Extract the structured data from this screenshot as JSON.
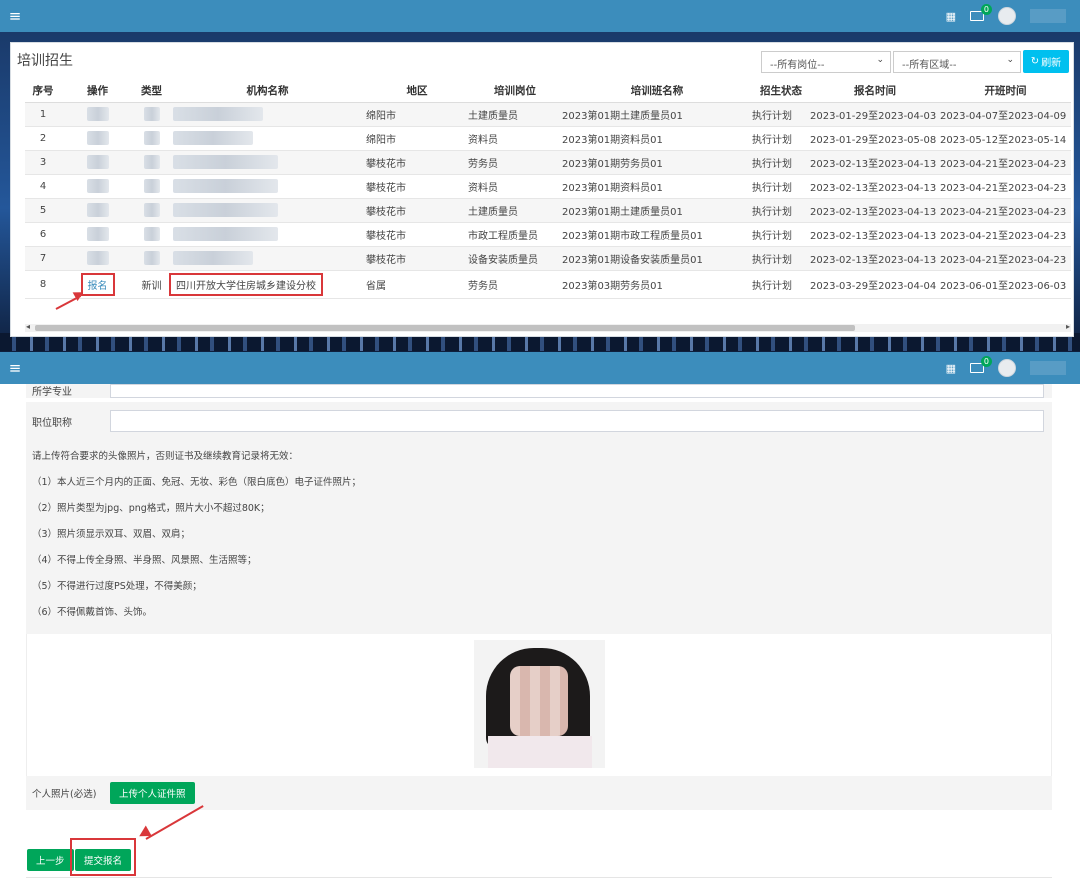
{
  "topbar": {
    "menu_icon": "hamburger-icon",
    "badge_count": "0"
  },
  "panel1": {
    "title": "培训招生",
    "filter_post": "--所有岗位--",
    "filter_area": "--所有区域--",
    "refresh_label": "刷新",
    "columns": [
      "序号",
      "操作",
      "类型",
      "机构名称",
      "地区",
      "培训岗位",
      "培训班名称",
      "招生状态",
      "报名时间",
      "开班时间"
    ],
    "rows": [
      {
        "no": "1",
        "op": "",
        "type": "",
        "org": "",
        "area": "绵阳市",
        "post": "土建质量员",
        "cls": "2023第01期土建质量员01",
        "status": "执行计划",
        "reg": "2023-01-29至2023-04-03",
        "start": "2023-04-07至2023-04-09"
      },
      {
        "no": "2",
        "op": "",
        "type": "",
        "org": "",
        "area": "绵阳市",
        "post": "资料员",
        "cls": "2023第01期资料员01",
        "status": "执行计划",
        "reg": "2023-01-29至2023-05-08",
        "start": "2023-05-12至2023-05-14"
      },
      {
        "no": "3",
        "op": "",
        "type": "",
        "org": "",
        "area": "攀枝花市",
        "post": "劳务员",
        "cls": "2023第01期劳务员01",
        "status": "执行计划",
        "reg": "2023-02-13至2023-04-13",
        "start": "2023-04-21至2023-04-23"
      },
      {
        "no": "4",
        "op": "",
        "type": "",
        "org": "",
        "area": "攀枝花市",
        "post": "资料员",
        "cls": "2023第01期资料员01",
        "status": "执行计划",
        "reg": "2023-02-13至2023-04-13",
        "start": "2023-04-21至2023-04-23"
      },
      {
        "no": "5",
        "op": "",
        "type": "",
        "org": "",
        "area": "攀枝花市",
        "post": "土建质量员",
        "cls": "2023第01期土建质量员01",
        "status": "执行计划",
        "reg": "2023-02-13至2023-04-13",
        "start": "2023-04-21至2023-04-23"
      },
      {
        "no": "6",
        "op": "",
        "type": "",
        "org": "",
        "area": "攀枝花市",
        "post": "市政工程质量员",
        "cls": "2023第01期市政工程质量员01",
        "status": "执行计划",
        "reg": "2023-02-13至2023-04-13",
        "start": "2023-04-21至2023-04-23"
      },
      {
        "no": "7",
        "op": "",
        "type": "",
        "org": "",
        "area": "攀枝花市",
        "post": "设备安装质量员",
        "cls": "2023第01期设备安装质量员01",
        "status": "执行计划",
        "reg": "2023-02-13至2023-04-13",
        "start": "2023-04-21至2023-04-23"
      },
      {
        "no": "8",
        "op": "报名",
        "type": "新训",
        "org": "四川开放大学住房城乡建设分校",
        "area": "省属",
        "post": "劳务员",
        "cls": "2023第03期劳务员01",
        "status": "执行计划",
        "reg": "2023-03-29至2023-04-04",
        "start": "2023-06-01至2023-06-03"
      }
    ]
  },
  "form": {
    "major_label": "所学专业",
    "title_label": "职位职称",
    "notes": [
      "请上传符合要求的头像照片，否则证书及继续教育记录将无效：",
      "（1）本人近三个月内的正面、免冠、无妆、彩色（限白底色）电子证件照片；",
      "（2）照片类型为jpg、png格式，照片大小不超过80K；",
      "（3）照片须显示双耳、双眉、双肩；",
      "（4）不得上传全身照、半身照、风景照、生活照等；",
      "（5）不得进行过度PS处理，不得美颜；",
      "（6）不得佩戴首饰、头饰。"
    ],
    "photo_label": "个人照片(必选)",
    "upload_label": "上传个人证件照",
    "prev_label": "上一步",
    "submit_label": "提交报名"
  },
  "colors": {
    "header": "#3c8dbc",
    "primary_green": "#00a65a",
    "refresh": "#00c0ef",
    "highlight_red": "#d9373a"
  }
}
